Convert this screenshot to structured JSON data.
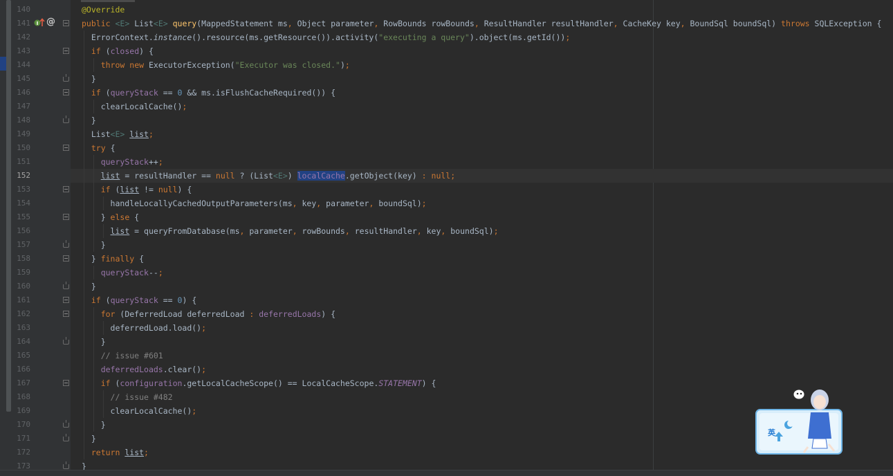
{
  "editor": {
    "current_line": "152",
    "lines": [
      {
        "num": "140",
        "text": "@Override"
      },
      {
        "num": "141",
        "text": "public <E> List<E> query(MappedStatement ms, Object parameter, RowBounds rowBounds, ResultHandler resultHandler, CacheKey key, BoundSql boundSql) throws SQLException {"
      },
      {
        "num": "142",
        "text": "  ErrorContext.instance().resource(ms.getResource()).activity(\"executing a query\").object(ms.getId());"
      },
      {
        "num": "143",
        "text": "  if (closed) {"
      },
      {
        "num": "144",
        "text": "    throw new ExecutorException(\"Executor was closed.\");"
      },
      {
        "num": "145",
        "text": "  }"
      },
      {
        "num": "146",
        "text": "  if (queryStack == 0 && ms.isFlushCacheRequired()) {"
      },
      {
        "num": "147",
        "text": "    clearLocalCache();"
      },
      {
        "num": "148",
        "text": "  }"
      },
      {
        "num": "149",
        "text": "  List<E> list;"
      },
      {
        "num": "150",
        "text": "  try {"
      },
      {
        "num": "151",
        "text": "    queryStack++;"
      },
      {
        "num": "152",
        "text": "    list = resultHandler == null ? (List<E>) localCache.getObject(key) : null;"
      },
      {
        "num": "153",
        "text": "    if (list != null) {"
      },
      {
        "num": "154",
        "text": "      handleLocallyCachedOutputParameters(ms, key, parameter, boundSql);"
      },
      {
        "num": "155",
        "text": "    } else {"
      },
      {
        "num": "156",
        "text": "      list = queryFromDatabase(ms, parameter, rowBounds, resultHandler, key, boundSql);"
      },
      {
        "num": "157",
        "text": "    }"
      },
      {
        "num": "158",
        "text": "  } finally {"
      },
      {
        "num": "159",
        "text": "    queryStack--;"
      },
      {
        "num": "160",
        "text": "  }"
      },
      {
        "num": "161",
        "text": "  if (queryStack == 0) {"
      },
      {
        "num": "162",
        "text": "    for (DeferredLoad deferredLoad : deferredLoads) {"
      },
      {
        "num": "163",
        "text": "      deferredLoad.load();"
      },
      {
        "num": "164",
        "text": "    }"
      },
      {
        "num": "165",
        "text": "    // issue #601"
      },
      {
        "num": "166",
        "text": "    deferredLoads.clear();"
      },
      {
        "num": "167",
        "text": "    if (configuration.getLocalCacheScope() == LocalCacheScope.STATEMENT) {"
      },
      {
        "num": "168",
        "text": "      // issue #482"
      },
      {
        "num": "169",
        "text": "      clearLocalCache();"
      },
      {
        "num": "170",
        "text": "    }"
      },
      {
        "num": "171",
        "text": "  }"
      },
      {
        "num": "172",
        "text": "  return list;"
      },
      {
        "num": "173",
        "text": "}"
      }
    ]
  },
  "gutter": {
    "override_icon": "override-up-arrow-icon",
    "annotation_icon": "at-sign-icon",
    "annotation_glyph": "@"
  },
  "overlay": {
    "mascot_label": "英",
    "mascot_icon": "input-method-mascot-icon"
  },
  "colors": {
    "background": "#2b2b2b",
    "keyword": "#cc7832",
    "field": "#9876aa",
    "string": "#6a8759",
    "number": "#6897bb",
    "comment": "#808080",
    "annotation": "#bbb529",
    "method_decl": "#ffc66d",
    "selection": "#214283"
  }
}
